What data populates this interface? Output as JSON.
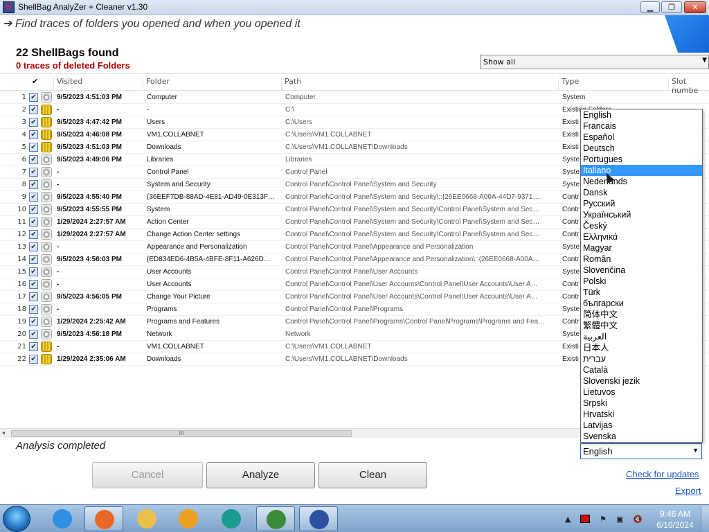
{
  "window": {
    "title": "ShellBag  AnalyZer + Cleaner v1.30",
    "min_label": "▁",
    "max_label": "❐",
    "close_label": "✕"
  },
  "app_icon_letter": "S",
  "tagline": "➔ Find traces of folders you opened and when you opened it",
  "summary": {
    "count": "22 ShellBags found",
    "deleted": "0 traces of deleted Folders"
  },
  "filter": {
    "value": "Show all",
    "arrow": "▼"
  },
  "columns": {
    "check": "✔",
    "visited": "Visited",
    "folder": "Folder",
    "path": "Path",
    "type": "Type",
    "slot": "Slot numbe"
  },
  "rows": [
    {
      "n": "1",
      "icon": "gear",
      "visited": "9/5/2023 4:51:03 PM",
      "folder": "Computer",
      "path": "Computer",
      "type": "System"
    },
    {
      "n": "2",
      "icon": "folder",
      "visited": "-",
      "folder": "-",
      "path": "C:\\",
      "type": "Existing Folders"
    },
    {
      "n": "3",
      "icon": "folder",
      "visited": "9/5/2023 4:47:42 PM",
      "folder": "Users",
      "path": "C:\\Users",
      "type": "Existi"
    },
    {
      "n": "4",
      "icon": "folder",
      "visited": "9/5/2023 4:46:08 PM",
      "folder": "VM1.COLLABNET",
      "path": "C:\\Users\\VM1.COLLABNET",
      "type": "Existi"
    },
    {
      "n": "5",
      "icon": "folder",
      "visited": "9/5/2023 4:51:03 PM",
      "folder": "Downloads",
      "path": "C:\\Users\\VM1.COLLABNET\\Downloads",
      "type": "Existi"
    },
    {
      "n": "6",
      "icon": "gear",
      "visited": "9/5/2023 4:49:06 PM",
      "folder": "Libraries",
      "path": "Libraries",
      "type": "Syste"
    },
    {
      "n": "7",
      "icon": "gear",
      "visited": "-",
      "folder": "Control Panel",
      "path": "Control Panel",
      "type": "Syste"
    },
    {
      "n": "8",
      "icon": "gear",
      "visited": "-",
      "folder": "System and Security",
      "path": "Control Panel\\Control Panel\\System and Security",
      "type": "Syste"
    },
    {
      "n": "9",
      "icon": "gear",
      "visited": "9/5/2023 4:55:40 PM",
      "folder": "{36EEF7DB-88AD-4E81-AD49-0E313F…",
      "path": "Control Panel\\Control Panel\\System and Security\\::{26EE0668-A00A-44D7-9371…",
      "type": "Contr"
    },
    {
      "n": "10",
      "icon": "gear",
      "visited": "9/5/2023 4:55:55 PM",
      "folder": "System",
      "path": "Control Panel\\Control Panel\\System and Security\\Control Panel\\System and Sec…",
      "type": "Contr"
    },
    {
      "n": "11",
      "icon": "gear",
      "visited": "1/29/2024 2:27:57 AM",
      "folder": "Action Center",
      "path": "Control Panel\\Control Panel\\System and Security\\Control Panel\\System and Sec…",
      "type": "Contr"
    },
    {
      "n": "12",
      "icon": "gear",
      "visited": "1/29/2024 2:27:57 AM",
      "folder": "Change Action Center settings",
      "path": "Control Panel\\Control Panel\\System and Security\\Control Panel\\System and Sec…",
      "type": "Contr"
    },
    {
      "n": "13",
      "icon": "gear",
      "visited": "-",
      "folder": "Appearance and Personalization",
      "path": "Control Panel\\Control Panel\\Appearance and Personalization",
      "type": "Syste"
    },
    {
      "n": "14",
      "icon": "gear",
      "visited": "9/5/2023 4:56:03 PM",
      "folder": "{ED834ED6-4B5A-4BFE-8F11-A626D…",
      "path": "Control Panel\\Control Panel\\Appearance and Personalization\\::{26EE0668-A00A…",
      "type": "Contr"
    },
    {
      "n": "15",
      "icon": "gear",
      "visited": "-",
      "folder": "User Accounts",
      "path": "Control Panel\\Control Panel\\User Accounts",
      "type": "Syste"
    },
    {
      "n": "16",
      "icon": "gear",
      "visited": "-",
      "folder": "User Accounts",
      "path": "Control Panel\\Control Panel\\User Accounts\\Control Panel\\User Accounts\\User A…",
      "type": "Contr"
    },
    {
      "n": "17",
      "icon": "gear",
      "visited": "9/5/2023 4:56:05 PM",
      "folder": "Change Your Picture",
      "path": "Control Panel\\Control Panel\\User Accounts\\Control Panel\\User Accounts\\User A…",
      "type": "Contr"
    },
    {
      "n": "18",
      "icon": "gear",
      "visited": "-",
      "folder": "Programs",
      "path": "Control Panel\\Control Panel\\Programs",
      "type": "Syste"
    },
    {
      "n": "19",
      "icon": "gear",
      "visited": "1/29/2024 2:25:42 AM",
      "folder": "Programs and Features",
      "path": "Control Panel\\Control Panel\\Programs\\Control Panel\\Programs\\Programs and Fea…",
      "type": "Contr"
    },
    {
      "n": "20",
      "icon": "gear",
      "visited": "9/5/2023 4:56:18 PM",
      "folder": "Network",
      "path": "Network",
      "type": "Syste"
    },
    {
      "n": "21",
      "icon": "folder",
      "visited": "-",
      "folder": "VM1.COLLABNET",
      "path": "C:\\Users\\VM1.COLLABNET",
      "type": "Existi"
    },
    {
      "n": "22",
      "icon": "folder",
      "visited": "1/29/2024 2:35:06 AM",
      "folder": "Downloads",
      "path": "C:\\Users\\VM1.COLLABNET\\Downloads",
      "type": "Existi"
    }
  ],
  "check_mark": "✔",
  "hscroll": {
    "left_arrow": "◂",
    "grip": "III"
  },
  "status": "Analysis completed",
  "buttons": {
    "cancel": "Cancel",
    "analyze": "Analyze",
    "clean": "Clean"
  },
  "links": {
    "updates": "Check for updates",
    "export": "Export"
  },
  "language": {
    "selected": "English",
    "arrow": "▼",
    "highlighted_index": 5,
    "options": [
      "English",
      "Francais",
      "Español",
      "Deutsch",
      "Portugues",
      "Italiano",
      "Nederlands",
      "Dansk",
      "Русский",
      "Український",
      "Český",
      "Ελληνικά",
      "Magyar",
      "Român",
      "Slovenčina",
      "Polski",
      "Türk",
      "български",
      "简体中文",
      "繁體中文",
      "العربية",
      "日本人",
      "עברית",
      "Català",
      "Slovenski jezik",
      "Lietuvos",
      "Srpski",
      "Hrvatski",
      "Latvijas",
      "Svenska"
    ]
  },
  "taskbar": {
    "apps": [
      {
        "name": "internet-explorer",
        "color": "#2f8fe0",
        "active": false
      },
      {
        "name": "firefox",
        "color": "#e8682a",
        "active": true
      },
      {
        "name": "explorer",
        "color": "#e9c14a",
        "active": false
      },
      {
        "name": "media-player",
        "color": "#f0a020",
        "active": false
      },
      {
        "name": "app-teal",
        "color": "#1b9a8f",
        "active": false
      },
      {
        "name": "app-green",
        "color": "#3c8a3c",
        "active": true
      },
      {
        "name": "shellbag-analyzer",
        "color": "#2d4fa0",
        "active": true
      }
    ],
    "tray": {
      "arrow": "▲",
      "flag": "⚑",
      "net": "▣",
      "vol": "🔇"
    },
    "time": "9:46 AM",
    "date": "6/10/2024"
  }
}
